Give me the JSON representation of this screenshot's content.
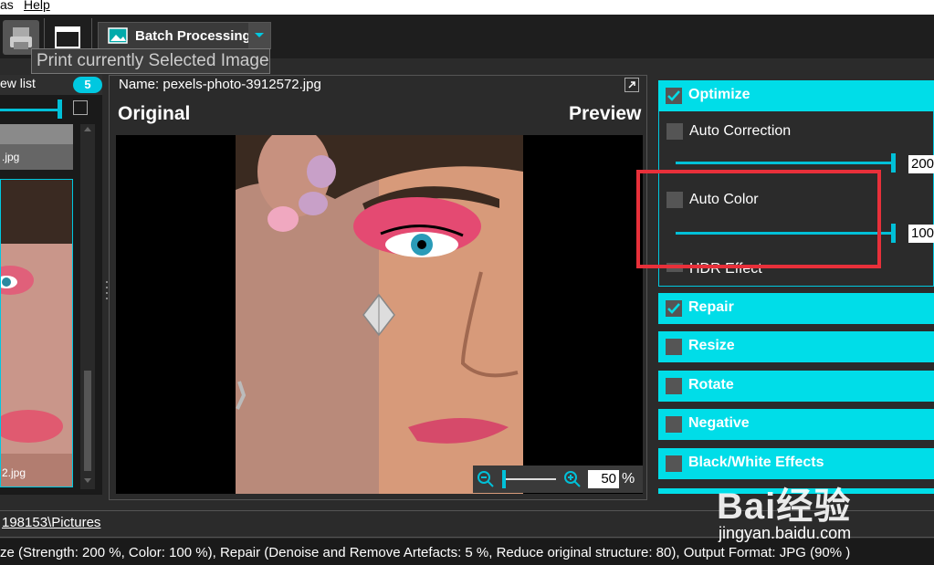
{
  "menu": {
    "items": [
      "as",
      "Help"
    ]
  },
  "toolbar": {
    "batch_label": "Batch Processing",
    "tooltip": "Print currently Selected Image"
  },
  "left": {
    "list_title": "ew list",
    "count": "5",
    "thumbs": [
      ".jpg",
      "2.jpg"
    ]
  },
  "center": {
    "name_label": "Name: pexels-photo-3912572.jpg",
    "original_label": "Original",
    "preview_label": "Preview",
    "zoom_value": "50",
    "zoom_unit": "%"
  },
  "right": {
    "optimize": {
      "label": "Optimize",
      "checked": true
    },
    "auto_correction": {
      "label": "Auto Correction",
      "value": "200"
    },
    "auto_color": {
      "label": "Auto Color",
      "value": "100"
    },
    "hdr_label": "HDR Effect",
    "sections": [
      {
        "label": "Repair",
        "checked": true
      },
      {
        "label": "Resize",
        "checked": false
      },
      {
        "label": "Rotate",
        "checked": false
      },
      {
        "label": "Negative",
        "checked": false
      },
      {
        "label": "Black/White Effects",
        "checked": false
      }
    ]
  },
  "path": "198153\\Pictures",
  "status": "ze (Strength: 200 %, Color: 100 %), Repair (Denoise and Remove Artefacts: 5 %, Reduce original structure: 80), Output Format: JPG (90% )",
  "watermark": {
    "line1": "Bai经验",
    "line2": "jingyan.baidu.com"
  },
  "colors": {
    "accent": "#00dde8",
    "highlight": "#e8303a"
  }
}
